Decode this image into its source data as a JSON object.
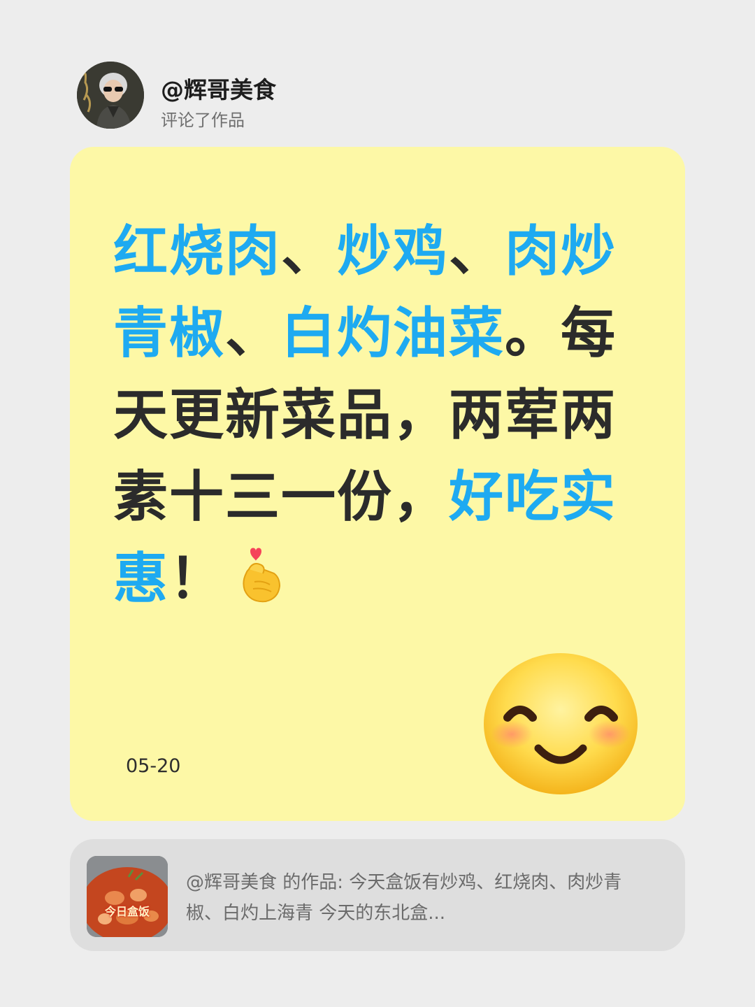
{
  "header": {
    "username": "@辉哥美食",
    "action": "评论了作品"
  },
  "comment": {
    "segments": [
      {
        "text": "红烧肉",
        "highlight": true
      },
      {
        "text": "、",
        "highlight": false
      },
      {
        "text": "炒鸡",
        "highlight": true
      },
      {
        "text": "、",
        "highlight": false
      },
      {
        "text": "肉炒青椒",
        "highlight": true
      },
      {
        "text": "、",
        "highlight": false
      },
      {
        "text": "白灼油菜",
        "highlight": true
      },
      {
        "text": "。每天更新菜品，两荤两素十三一份，",
        "highlight": false
      },
      {
        "text": "好吃实惠",
        "highlight": true
      },
      {
        "text": "！",
        "highlight": false
      }
    ],
    "inline_emoji": "finger-heart-icon",
    "date": "05-20",
    "corner_emoji": "smiling-face-icon"
  },
  "reference": {
    "thumbnail_label": "今日盒饭",
    "text": "@辉哥美食 的作品: 今天盒饭有炒鸡、红烧肉、肉炒青椒、白灼上海青 今天的东北盒..."
  },
  "colors": {
    "background": "#ededed",
    "card": "#fdf8a6",
    "highlight": "#1eaaf1",
    "text": "#2b2b2b",
    "reference_card": "#dedede"
  }
}
